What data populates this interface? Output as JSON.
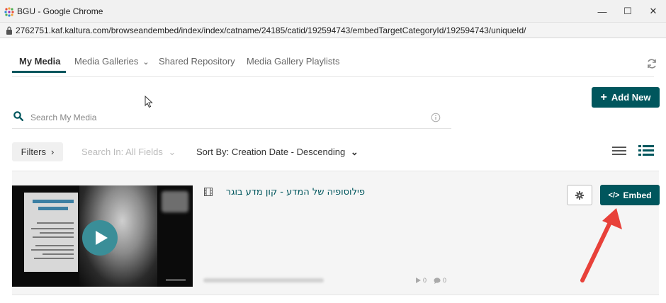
{
  "window": {
    "title": "BGU - Google Chrome",
    "url": "2762751.kaf.kaltura.com/browseandembed/index/index/catname/24185/catid/192594743/embedTargetCategoryId/192594743/uniqueId/",
    "minimize_glyph": "—",
    "maximize_glyph": "☐",
    "close_glyph": "✕"
  },
  "nav": {
    "tabs": [
      {
        "label": "My Media",
        "active": true
      },
      {
        "label": "Media Galleries",
        "has_dropdown": true
      },
      {
        "label": "Shared Repository"
      },
      {
        "label": "Media Gallery Playlists"
      }
    ],
    "dropdown_glyph": "⌄"
  },
  "actions": {
    "add_new_label": "Add New",
    "add_new_glyph": "+"
  },
  "search": {
    "placeholder": "Search My Media",
    "value": ""
  },
  "toolbar": {
    "filters_label": "Filters",
    "filters_glyph": "›",
    "search_in_label": "Search In: All Fields",
    "search_in_glyph": "⌄",
    "sort_label": "Sort By: Creation Date - Descending",
    "sort_glyph": "⌄"
  },
  "entry": {
    "title": "פילוסופיה של המדע - קון מדע בוגר",
    "plays": "0",
    "comments": "0",
    "embed_label": "Embed",
    "embed_glyph": "</>"
  },
  "colors": {
    "accent": "#00565d",
    "play": "#3a8e98",
    "arrow": "#e8413a"
  },
  "icons": [
    "app-icon",
    "lock-icon",
    "refresh-icon",
    "search-icon",
    "info-icon",
    "list-view-icon",
    "detail-view-icon",
    "film-icon",
    "play-icon",
    "plays-icon",
    "comments-icon",
    "gear-icon",
    "annotation-arrow"
  ]
}
